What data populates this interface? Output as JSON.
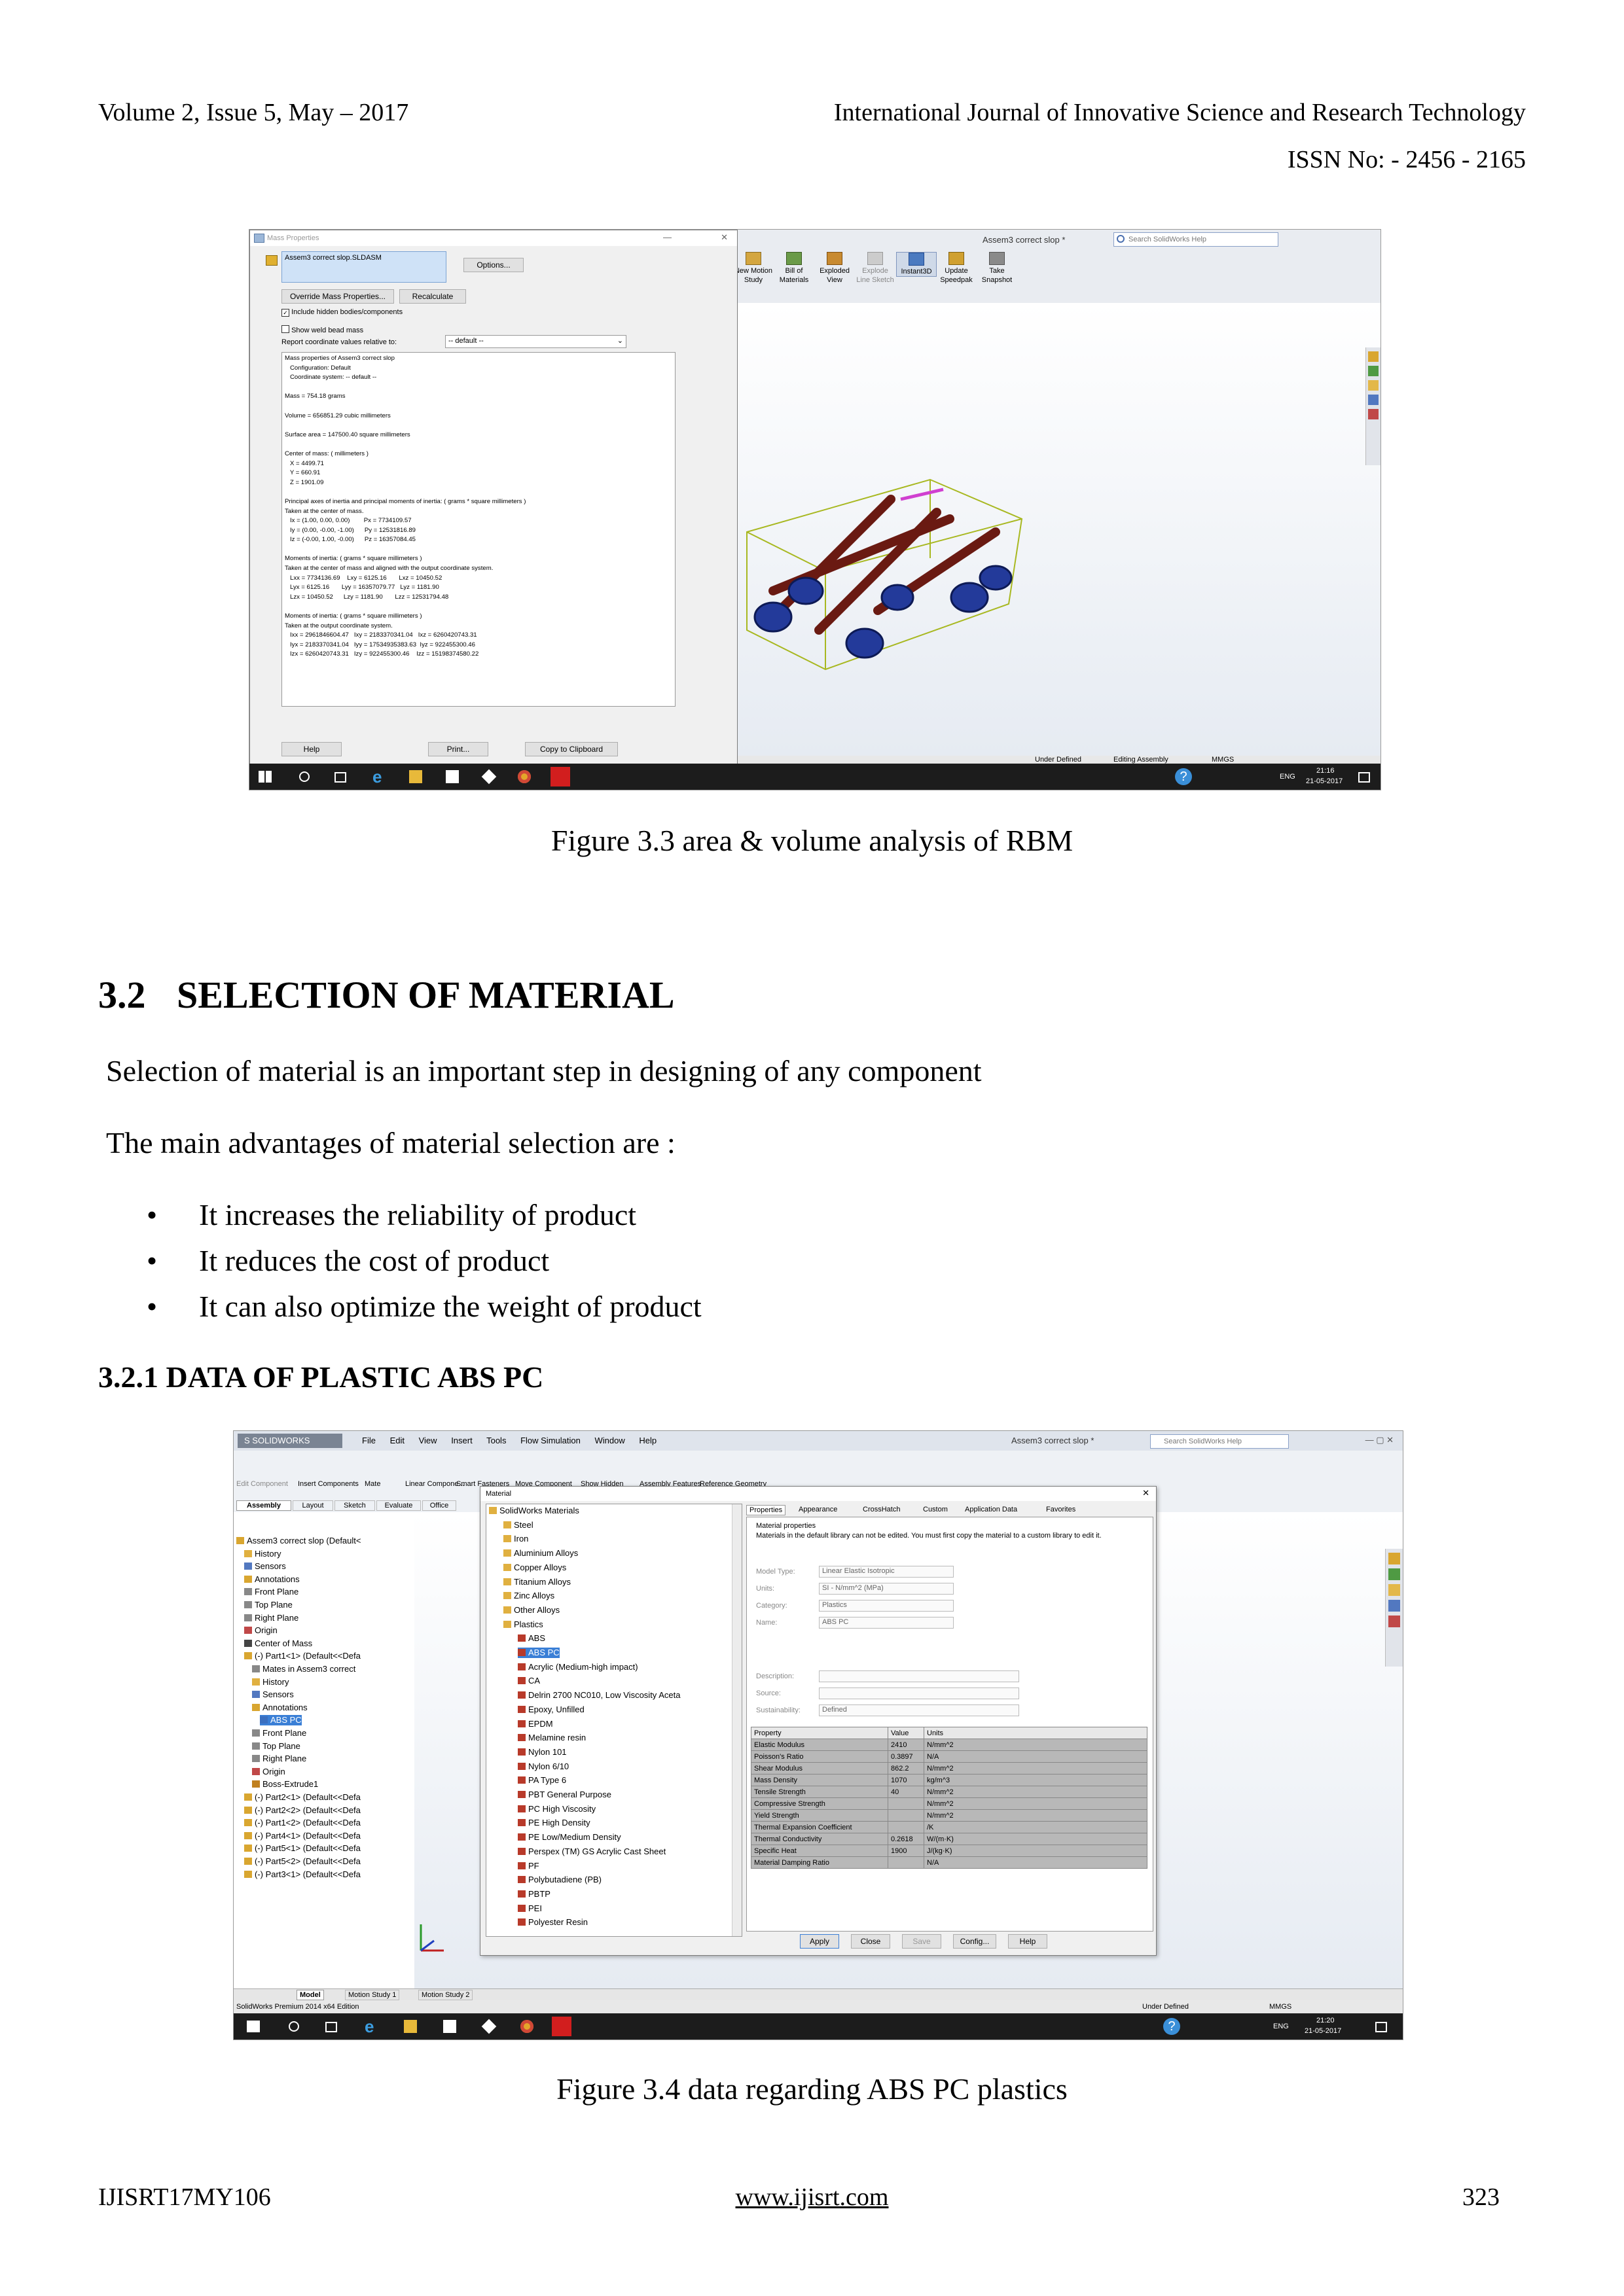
{
  "header": {
    "left": "Volume 2, Issue 5, May – 2017",
    "right": "International Journal of Innovative Science and Research Technology",
    "issn": "ISSN No: - 2456 - 2165"
  },
  "figure1": {
    "caption": "Figure 3.3 area & volume analysis of RBM",
    "mass_dialog": {
      "title": "Mass Properties",
      "selected": "Assem3 correct slop.SLDASM",
      "options_button": "Options...",
      "override_button": "Override Mass Properties...",
      "recalculate_button": "Recalculate",
      "include_hidden": "Include hidden bodies/components",
      "show_weld": "Show weld bead mass",
      "report_label": "Report coordinate values relative to:",
      "report_value": "-- default --",
      "results": [
        "Mass properties of Assem3 correct slop",
        "   Configuration: Default",
        "   Coordinate system: -- default --",
        "",
        "Mass = 754.18 grams",
        "",
        "Volume = 656851.29 cubic millimeters",
        "",
        "Surface area = 147500.40 square millimeters",
        "",
        "Center of mass: ( millimeters )",
        "   X = 4499.71",
        "   Y = 660.91",
        "   Z = 1901.09",
        "",
        "Principal axes of inertia and principal moments of inertia: ( grams * square millimeters )",
        "Taken at the center of mass.",
        "   Ix = (1.00, 0.00, 0.00)        Px = 7734109.57",
        "   Iy = (0.00, -0.00, -1.00)      Py = 12531816.89",
        "   Iz = (-0.00, 1.00, -0.00)      Pz = 16357084.45",
        "",
        "Moments of inertia: ( grams * square millimeters )",
        "Taken at the center of mass and aligned with the output coordinate system.",
        "   Lxx = 7734136.69    Lxy = 6125.16       Lxz = 10450.52",
        "   Lyx = 6125.16       Lyy = 16357079.77   Lyz = 1181.90",
        "   Lzx = 10450.52      Lzy = 1181.90       Lzz = 12531794.48",
        "",
        "Moments of inertia: ( grams * square millimeters )",
        "Taken at the output coordinate system.",
        "   Ixx = 2961846604.47   Ixy = 2183370341.04   Ixz = 6260420743.31",
        "   Iyx = 2183370341.04   Iyy = 17534935383.63  Iyz = 922455300.46",
        "   Izx = 6260420743.31   Izy = 922455300.46    Izz = 15198374580.22"
      ],
      "help_button": "Help",
      "print_button": "Print...",
      "copy_button": "Copy to Clipboard"
    },
    "toolbar": {
      "doc_title": "Assem3 correct slop *",
      "search_placeholder": "Search SolidWorks Help",
      "buttons": [
        "New Motion Study",
        "Bill of Materials",
        "Exploded View",
        "Explode Line Sketch",
        "Instant3D",
        "Update Speedpak",
        "Take Snapshot"
      ]
    },
    "status": {
      "left": "Under Defined",
      "mid": "Editing Assembly",
      "units": "MMGS"
    },
    "taskbar": {
      "lang": "ENG",
      "time": "21:16",
      "date": "21-05-2017"
    }
  },
  "section": {
    "heading_num": "3.2",
    "heading": "SELECTION OF MATERIAL",
    "para1": "Selection of material is an important step in designing of any component",
    "para2": "The main advantages of material selection are  :",
    "bullets": [
      "It increases the reliability of product",
      "It reduces the cost of product",
      "It can also optimize the weight of product"
    ],
    "subheading": "3.2.1 DATA OF PLASTIC ABS PC"
  },
  "figure2": {
    "caption": "Figure 3.4 data regarding ABS PC plastics",
    "menubar": [
      "File",
      "Edit",
      "View",
      "Insert",
      "Tools",
      "Flow Simulation",
      "Window",
      "Help"
    ],
    "doc_title": "Assem3 correct slop *",
    "search_placeholder": "Search SolidWorks Help",
    "cmd_buttons": [
      "Edit Component",
      "Insert Components",
      "Mate",
      "Linear Compone...",
      "Smart Fasteners",
      "Move Component",
      "Show Hidden",
      "Assembly Features",
      "Reference Geometry"
    ],
    "cmd_tabs": [
      "Assembly",
      "Layout",
      "Sketch",
      "Evaluate",
      "Office"
    ],
    "tree": [
      "Assem3 correct slop (Default<",
      "History",
      "Sensors",
      "Annotations",
      "Front Plane",
      "Top Plane",
      "Right Plane",
      "Origin",
      "Center of Mass",
      "(-) Part1<1> (Default<<Defa",
      "Mates in Assem3 correct",
      "History",
      "Sensors",
      "Annotations",
      "ABS PC",
      "Front Plane",
      "Top Plane",
      "Right Plane",
      "Origin",
      "Boss-Extrude1",
      "(-) Part2<1> (Default<<Defa",
      "(-) Part2<2> (Default<<Defa",
      "(-) Part1<2> (Default<<Defa",
      "(-) Part4<1> (Default<<Defa",
      "(-) Part5<1> (Default<<Defa",
      "(-) Part5<2> (Default<<Defa",
      "(-) Part3<1> (Default<<Defa"
    ],
    "material_dialog": {
      "title": "Material",
      "library": [
        "SolidWorks Materials",
        "Steel",
        "Iron",
        "Aluminium Alloys",
        "Copper Alloys",
        "Titanium Alloys",
        "Zinc Alloys",
        "Other Alloys",
        "Plastics",
        "ABS",
        "ABS PC",
        "Acrylic (Medium-high impact)",
        "CA",
        "Delrin 2700 NC010, Low Viscosity Aceta",
        "Epoxy, Unfilled",
        "EPDM",
        "Melamine resin",
        "Nylon 101",
        "Nylon 6/10",
        "PA Type 6",
        "PBT General Purpose",
        "PC High Viscosity",
        "PE High Density",
        "PE Low/Medium Density",
        "Perspex (TM) GS Acrylic Cast Sheet",
        "PF",
        "Polybutadiene (PB)",
        "PBTP",
        "PEI",
        "Polyester Resin"
      ],
      "tabs": [
        "Properties",
        "Appearance",
        "CrossHatch",
        "Custom",
        "Application Data",
        "Favorites"
      ],
      "group_label": "Material properties",
      "note": "Materials in the default library can not be edited. You must first copy the material to a custom library to edit it.",
      "fields": [
        {
          "label": "Model Type:",
          "value": "Linear Elastic Isotropic"
        },
        {
          "label": "Units:",
          "value": "SI - N/mm^2 (MPa)"
        },
        {
          "label": "Category:",
          "value": "Plastics"
        },
        {
          "label": "Name:",
          "value": "ABS PC"
        }
      ],
      "fields2": [
        {
          "label": "Description:",
          "value": ""
        },
        {
          "label": "Source:",
          "value": ""
        },
        {
          "label": "Sustainability:",
          "value": "Defined"
        }
      ],
      "table_headers": [
        "Property",
        "Value",
        "Units"
      ],
      "table_rows": [
        [
          "Elastic Modulus",
          "2410",
          "N/mm^2"
        ],
        [
          "Poisson's Ratio",
          "0.3897",
          "N/A"
        ],
        [
          "Shear Modulus",
          "862.2",
          "N/mm^2"
        ],
        [
          "Mass Density",
          "1070",
          "kg/m^3"
        ],
        [
          "Tensile Strength",
          "40",
          "N/mm^2"
        ],
        [
          "Compressive Strength",
          "",
          "N/mm^2"
        ],
        [
          "Yield Strength",
          "",
          "N/mm^2"
        ],
        [
          "Thermal Expansion Coefficient",
          "",
          "/K"
        ],
        [
          "Thermal Conductivity",
          "0.2618",
          "W/(m·K)"
        ],
        [
          "Specific Heat",
          "1900",
          "J/(kg·K)"
        ],
        [
          "Material Damping Ratio",
          "",
          "N/A"
        ]
      ],
      "buttons": [
        "Apply",
        "Close",
        "Save",
        "Config...",
        "Help"
      ]
    },
    "bottom_tabs": [
      "Model",
      "Motion Study 1",
      "Motion Study 2"
    ],
    "edition": "SolidWorks Premium 2014 x64 Edition",
    "status": {
      "left": "Under Defined",
      "units": "MMGS"
    },
    "taskbar": {
      "lang": "ENG",
      "time": "21:20",
      "date": "21-05-2017"
    }
  },
  "footer": {
    "left": "IJISRT17MY106",
    "center": "www.ijisrt.com",
    "page": "323"
  }
}
